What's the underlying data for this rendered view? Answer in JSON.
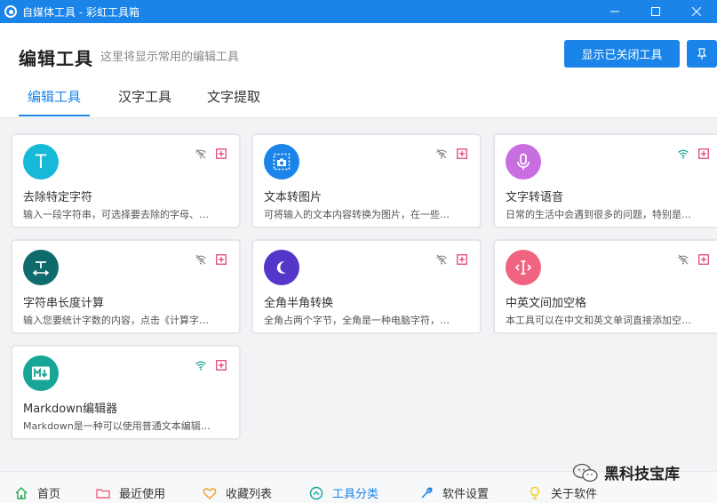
{
  "window": {
    "title": "自媒体工具 - 彩虹工具箱",
    "controls": [
      "minimize-icon",
      "maximize-icon",
      "close-icon"
    ]
  },
  "header": {
    "title": "编辑工具",
    "subtitle": "这里将显示常用的编辑工具",
    "show_closed_button": "显示已关闭工具",
    "pin_icon": "pin-icon"
  },
  "tabs": [
    {
      "label": "编辑工具",
      "active": true
    },
    {
      "label": "汉字工具",
      "active": false
    },
    {
      "label": "文字提取",
      "active": false
    }
  ],
  "cards": [
    {
      "name": "去除特定字符",
      "desc": "输入一段字符串，可选择要去除的字母、…",
      "icon": "letter-t-icon",
      "color": "#17b9d8",
      "wifi": "off"
    },
    {
      "name": "文本转图片",
      "desc": "可将输入的文本内容转换为图片，在一些…",
      "icon": "text-to-image-icon",
      "color": "#1a84e8",
      "wifi": "off"
    },
    {
      "name": "文字转语音",
      "desc": "日常的生活中会遇到很多的问题，特别是…",
      "icon": "microphone-icon",
      "color": "#c86ee0",
      "wifi": "on"
    },
    {
      "name": "字符串长度计算",
      "desc": "输入您要统计字数的内容，点击《计算字…",
      "icon": "text-width-icon",
      "color": "#0f6b6b",
      "wifi": "off"
    },
    {
      "name": "全角半角转换",
      "desc": "全角占两个字节，全角是一种电脑字符，…",
      "icon": "moon-icon",
      "color": "#5436c9",
      "wifi": "off"
    },
    {
      "name": "中英文间加空格",
      "desc": "本工具可以在中文和英文单词直接添加空…",
      "icon": "text-cursor-icon",
      "color": "#f06482",
      "wifi": "off"
    },
    {
      "name": "Markdown编辑器",
      "desc": "Markdown是一种可以使用普通文本编辑…",
      "icon": "markdown-icon",
      "color": "#17a596",
      "wifi": "on"
    }
  ],
  "bottom_nav": [
    {
      "label": "首页",
      "icon": "home-icon",
      "color": "#2faa5a",
      "active": false
    },
    {
      "label": "最近使用",
      "icon": "folder-icon",
      "color": "#f06482",
      "active": false
    },
    {
      "label": "收藏列表",
      "icon": "heart-icon",
      "color": "#f0a020",
      "active": false
    },
    {
      "label": "工具分类",
      "icon": "chevron-up-circle-icon",
      "color": "#17a596",
      "active": true
    },
    {
      "label": "软件设置",
      "icon": "wrench-icon",
      "color": "#1a84e8",
      "active": false
    },
    {
      "label": "关于软件",
      "icon": "lightbulb-icon",
      "color": "#f0d020",
      "active": false
    }
  ],
  "watermark": {
    "text": "黑科技宝库",
    "icon": "wechat-icon"
  },
  "colors": {
    "accent": "#1a84e8",
    "badge_pink": "#e0457a",
    "wifi_off": "#888888",
    "wifi_on": "#17a596"
  }
}
